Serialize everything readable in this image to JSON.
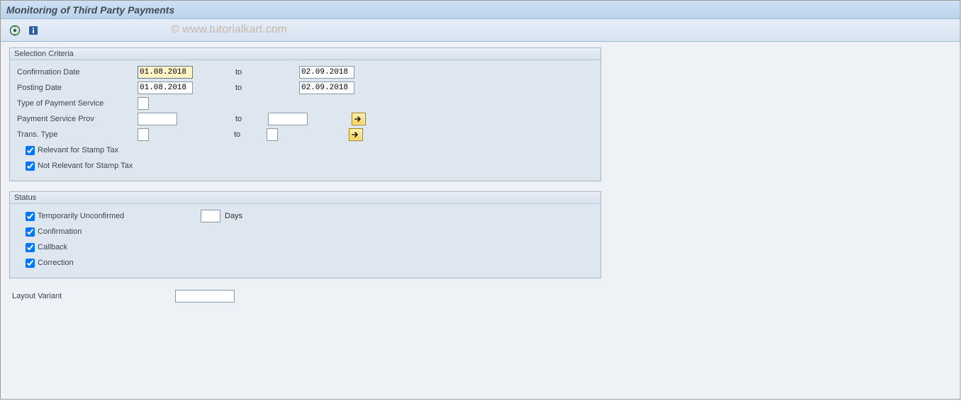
{
  "title": "Monitoring of Third Party Payments",
  "watermark": "© www.tutorialkart.com",
  "selection": {
    "legend": "Selection Criteria",
    "rows": {
      "confirmation_date": {
        "label": "Confirmation Date",
        "from": "01.08.2018",
        "to_label": "to",
        "to": "02.09.2018"
      },
      "posting_date": {
        "label": "Posting Date",
        "from": "01.08.2018",
        "to_label": "to",
        "to": "02.09.2018"
      },
      "payment_service_type": {
        "label": "Type of Payment Service",
        "value": ""
      },
      "payment_service_prov": {
        "label": "Payment Service Prov",
        "from": "",
        "to_label": "to",
        "to": ""
      },
      "trans_type": {
        "label": "Trans. Type",
        "from": "",
        "to_label": "to",
        "to": ""
      },
      "relevant_stamp": {
        "label": "Relevant for Stamp Tax",
        "checked": true
      },
      "not_relevant_stamp": {
        "label": "Not Relevant for Stamp Tax",
        "checked": true
      }
    }
  },
  "status": {
    "legend": "Status",
    "temp_unconfirmed": {
      "label": "Temporarily Unconfirmed",
      "checked": true,
      "days_value": "",
      "days_label": "Days"
    },
    "confirmation": {
      "label": "Confirmation",
      "checked": true
    },
    "callback": {
      "label": "Callback",
      "checked": true
    },
    "correction": {
      "label": "Correction",
      "checked": true
    }
  },
  "layout_variant": {
    "label": "Layout Variant",
    "value": ""
  }
}
